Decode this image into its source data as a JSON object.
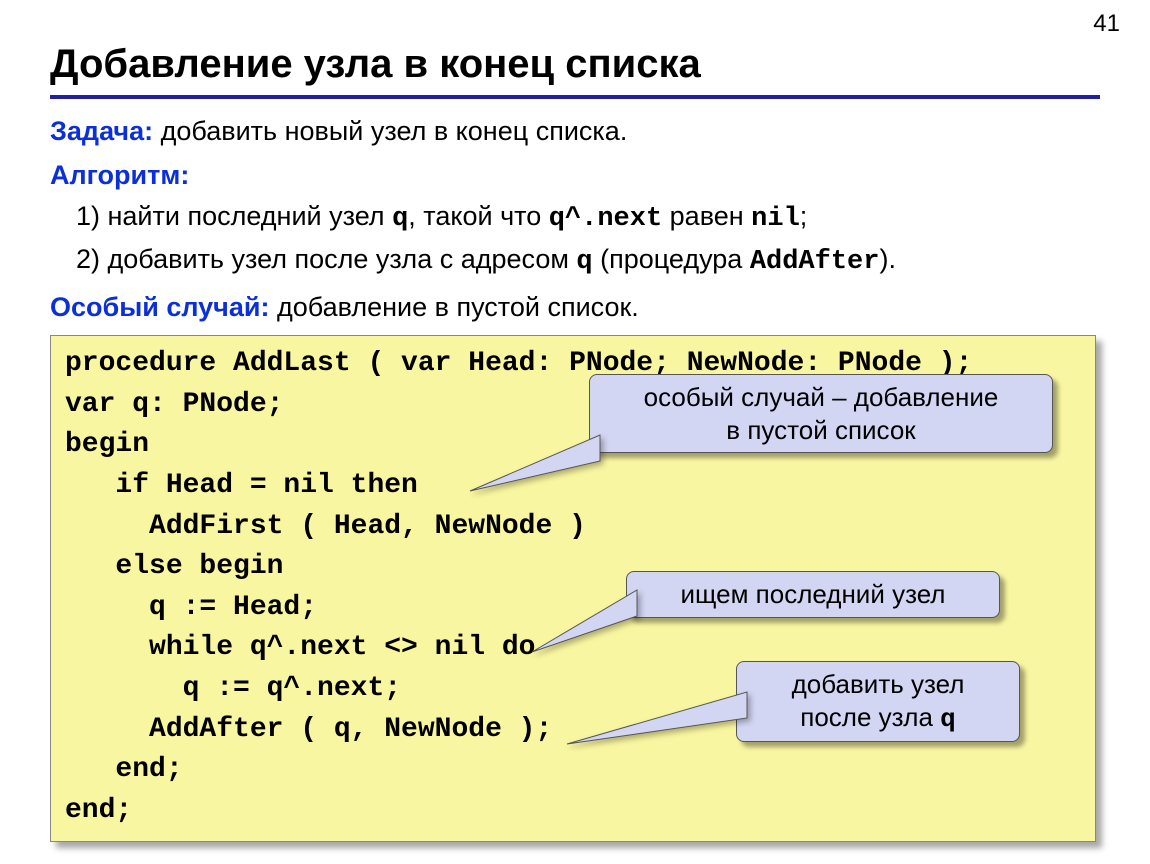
{
  "page_number": "41",
  "title": "Добавление узла в конец списка",
  "task_label": "Задача:",
  "task_text": "добавить новый узел в конец списка.",
  "algorithm_label": "Алгоритм:",
  "algo1_pre": "1)  найти последний узел ",
  "algo1_q": "q",
  "algo1_mid": ", такой что ",
  "algo1_qnext": "q^.next",
  "algo1_eq": " равен ",
  "algo1_nil": "nil",
  "algo1_end": ";",
  "algo2_pre": "2)  добавить узел после узла с адресом ",
  "algo2_q": "q",
  "algo2_mid": " (процедура ",
  "algo2_proc": "AddAfter",
  "algo2_end": ").",
  "special_label": "Особый случай:",
  "special_text": "добавление в пустой список.",
  "code": "procedure AddLast ( var Head: PNode; NewNode: PNode );\nvar q: PNode;\nbegin\n   if Head = nil then\n     AddFirst ( Head, NewNode )\n   else begin\n     q := Head;\n     while q^.next <> nil do\n       q := q^.next;\n     AddAfter ( q, NewNode );\n   end;\nend;",
  "callout1_line1": "особый случай – добавление",
  "callout1_line2": "в пустой список",
  "callout2_line1": "ищем последний узел",
  "callout3_line1": "добавить узел",
  "callout3_line2": "после узла ",
  "callout3_q": "q"
}
